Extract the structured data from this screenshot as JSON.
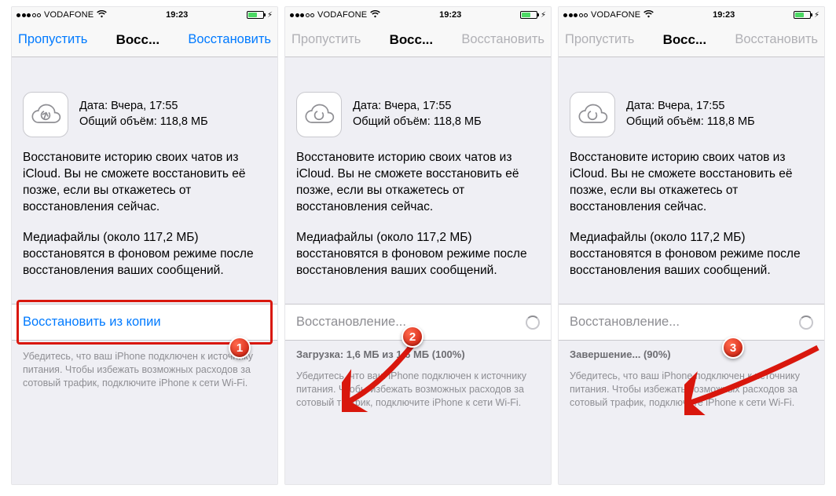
{
  "status": {
    "carrier": "VODAFONE",
    "time": "19:23"
  },
  "nav": {
    "skip": "Пропустить",
    "title": "Восс...",
    "restore": "Восстановить"
  },
  "backup": {
    "date_line": "Дата: Вчера, 17:55",
    "size_line": "Общий объём: 118,8 МБ"
  },
  "body": {
    "para1": "Восстановите историю своих чатов из iCloud. Вы не сможете восстановить её позже, если вы откажетесь от восстановления сейчас.",
    "para2": "Медиафайлы (около 117,2 МБ) восстановятся в фоновом режиме после восстановления ваших сообщений."
  },
  "screens": [
    {
      "action_label": "Восстановить из копии",
      "footer": "Убедитесь, что ваш iPhone подключен к источнику питания. Чтобы избежать возможных расходов за сотовый трафик, подключите iPhone к сети Wi-Fi."
    },
    {
      "action_label": "Восстановление...",
      "sub_status": "Загрузка: 1,6 МБ из 1,6 МБ (100%)",
      "footer": "Убедитесь, что ваш iPhone подключен к источнику питания. Чтобы избежать возможных расходов за сотовый трафик, подключите iPhone к сети Wi-Fi."
    },
    {
      "action_label": "Восстановление...",
      "sub_status": "Завершение... (90%)",
      "footer": "Убедитесь, что ваш iPhone подключен к источнику питания. Чтобы избежать возможных расходов за сотовый трафик, подключите iPhone к сети Wi-Fi."
    }
  ],
  "markers": {
    "m1": "1",
    "m2": "2",
    "m3": "3"
  }
}
